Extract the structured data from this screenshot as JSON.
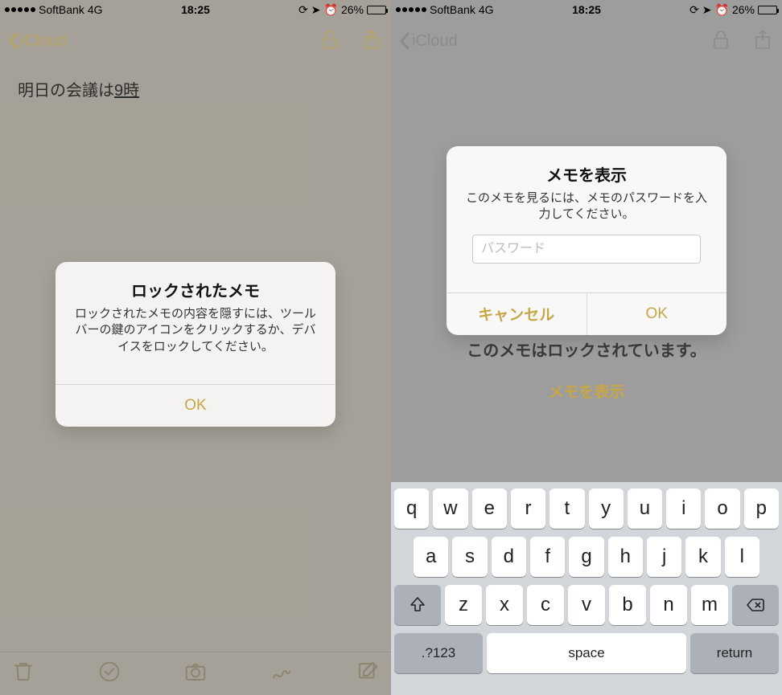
{
  "status": {
    "carrier": "SoftBank",
    "network": "4G",
    "time": "18:25",
    "battery_pct": "26%"
  },
  "nav": {
    "back_label": "iCloud"
  },
  "left": {
    "note_text_prefix": "明日の会議は",
    "note_text_underlined": "9時",
    "alert": {
      "title": "ロックされたメモ",
      "message": "ロックされたメモの内容を隠すには、ツールバーの鍵のアイコンをクリックするか、デバイスをロックしてください。",
      "ok": "OK"
    }
  },
  "right": {
    "alert": {
      "title": "メモを表示",
      "message": "このメモを見るには、メモのパスワードを入力してください。",
      "placeholder": "パスワード",
      "cancel": "キャンセル",
      "ok": "OK"
    },
    "locked_title": "このメモはロックされています。",
    "locked_link": "メモを表示"
  },
  "keyboard": {
    "row1": [
      "q",
      "w",
      "e",
      "r",
      "t",
      "y",
      "u",
      "i",
      "o",
      "p"
    ],
    "row2": [
      "a",
      "s",
      "d",
      "f",
      "g",
      "h",
      "j",
      "k",
      "l"
    ],
    "row3": [
      "z",
      "x",
      "c",
      "v",
      "b",
      "n",
      "m"
    ],
    "fn": ".?123",
    "space": "space",
    "return": "return"
  }
}
